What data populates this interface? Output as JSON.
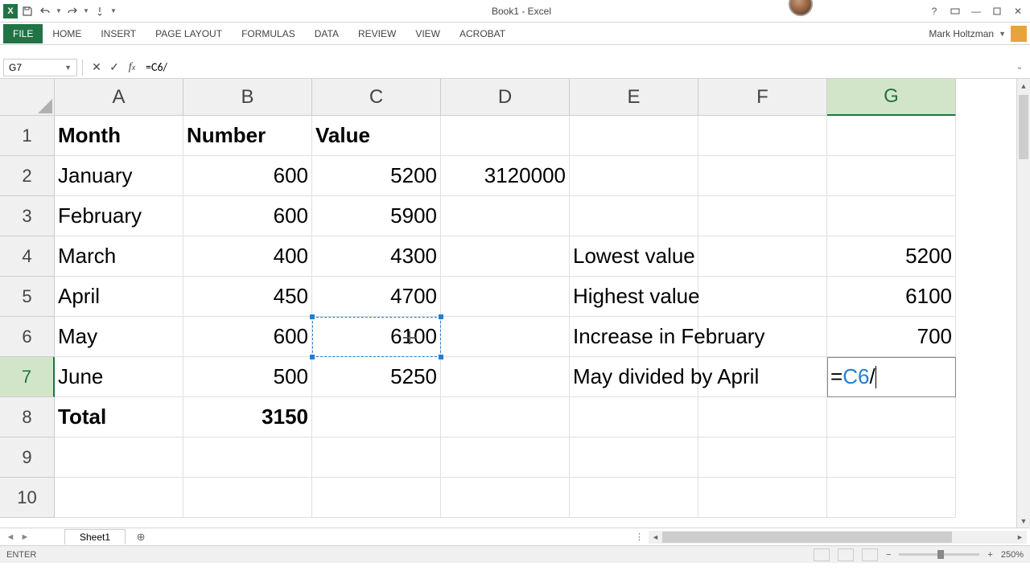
{
  "app": {
    "title": "Book1 - Excel",
    "user_name": "Mark Holtzman"
  },
  "tabs": {
    "file": "FILE",
    "home": "HOME",
    "insert": "INSERT",
    "page_layout": "PAGE LAYOUT",
    "formulas": "FORMULAS",
    "data": "DATA",
    "review": "REVIEW",
    "view": "VIEW",
    "acrobat": "ACROBAT"
  },
  "formula_bar": {
    "name_box": "G7",
    "formula": "=C6/"
  },
  "columns": [
    "A",
    "B",
    "C",
    "D",
    "E",
    "F",
    "G"
  ],
  "rows": [
    "1",
    "2",
    "3",
    "4",
    "5",
    "6",
    "7",
    "8",
    "9",
    "10"
  ],
  "cells": {
    "A1": "Month",
    "B1": "Number",
    "C1": "Value",
    "A2": "January",
    "B2": "600",
    "C2": "5200",
    "D2": "3120000",
    "A3": "February",
    "B3": "600",
    "C3": "5900",
    "A4": "March",
    "B4": "400",
    "C4": "4300",
    "E4": "Lowest value",
    "G4": "5200",
    "A5": "April",
    "B5": "450",
    "C5": "4700",
    "E5": "Highest value",
    "G5": "6100",
    "A6": "May",
    "B6": "600",
    "C6": "6100",
    "E6": "Increase in February",
    "G6": "700",
    "A7": "June",
    "B7": "500",
    "C7": "5250",
    "E7": "May divided by April",
    "A8": "Total",
    "B8": "3150"
  },
  "editing_cell": {
    "prefix": "=",
    "ref": "C6",
    "suffix": "/"
  },
  "sheet": {
    "name": "Sheet1"
  },
  "status": {
    "mode": "ENTER",
    "zoom": "250%"
  }
}
